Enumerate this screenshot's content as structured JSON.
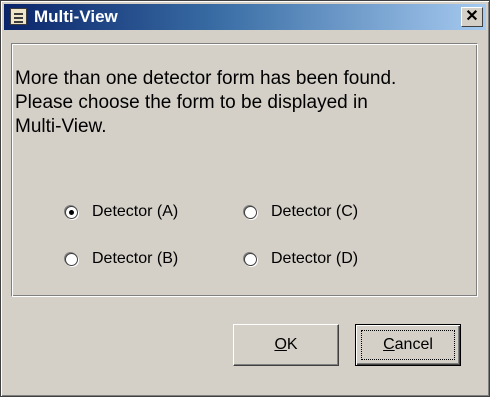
{
  "window": {
    "title": "Multi-View",
    "close_glyph": "✕",
    "icon": "form-icon"
  },
  "message": {
    "lines": [
      "More than one detector form has been found.",
      "Please choose the form to be displayed in",
      "Multi-View."
    ]
  },
  "options": [
    {
      "label": "Detector (A)",
      "checked": true
    },
    {
      "label": "Detector (C)",
      "checked": false
    },
    {
      "label": "Detector (B)",
      "checked": false
    },
    {
      "label": "Detector (D)",
      "checked": false
    }
  ],
  "buttons": {
    "ok": {
      "accel": "O",
      "rest": "K"
    },
    "cancel": {
      "accel": "C",
      "rest": "ancel"
    }
  }
}
